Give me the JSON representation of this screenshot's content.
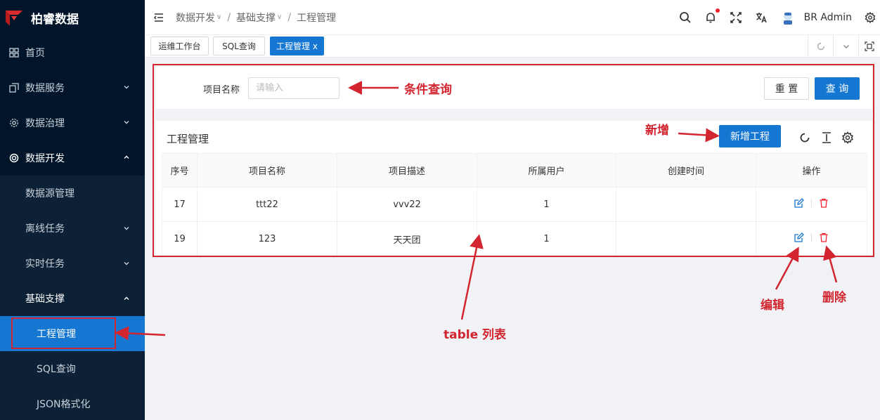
{
  "brand": {
    "name": "柏睿数据"
  },
  "sidebar": {
    "items": [
      {
        "label": "首页",
        "icon": "grid-icon"
      },
      {
        "label": "数据服务",
        "icon": "copy-icon"
      },
      {
        "label": "数据治理",
        "icon": "gear-icon"
      },
      {
        "label": "数据开发",
        "icon": "circle-icon"
      }
    ],
    "sub": [
      {
        "label": "数据源管理"
      },
      {
        "label": "离线任务"
      },
      {
        "label": "实时任务"
      },
      {
        "label": "基础支撑"
      }
    ],
    "deep": [
      {
        "label": "工程管理"
      },
      {
        "label": "SQL查询"
      },
      {
        "label": "JSON格式化"
      }
    ]
  },
  "breadcrumb": {
    "level1": "数据开发",
    "level2": "基础支撑",
    "level3": "工程管理"
  },
  "header": {
    "user": "BR Admin"
  },
  "tabs": [
    {
      "label": "运维工作台"
    },
    {
      "label": "SQL查询"
    },
    {
      "label": "工程管理 x"
    }
  ],
  "search": {
    "label": "项目名称",
    "placeholder": "请输入",
    "reset": "重 置",
    "query": "查 询"
  },
  "table": {
    "title": "工程管理",
    "add_button": "新增工程",
    "columns": [
      "序号",
      "项目名称",
      "项目描述",
      "所属用户",
      "创建时间",
      "操作"
    ],
    "rows": [
      [
        "17",
        "ttt22",
        "vvv22",
        "1",
        ""
      ],
      [
        "19",
        "123",
        "天天团",
        "1",
        ""
      ]
    ]
  },
  "annotations": {
    "condition_query": "条件查询",
    "add_new": "新增",
    "edit": "编辑",
    "delete": "删除",
    "table_list": "table 列表"
  },
  "colors": {
    "primary": "#1677d2",
    "sidebar": "#001529",
    "annotation": "#d3252f"
  }
}
